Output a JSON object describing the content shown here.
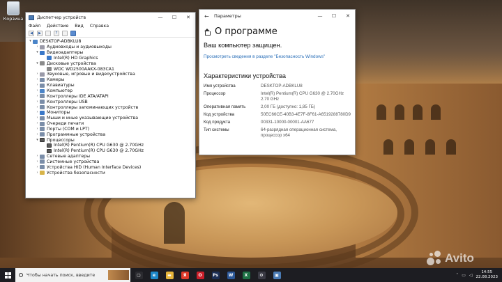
{
  "desktop": {
    "recycle_bin_label": "Корзина"
  },
  "device_manager": {
    "title": "Диспетчер устройств",
    "menu": [
      "Файл",
      "Действие",
      "Вид",
      "Справка"
    ],
    "tree": [
      {
        "level": 0,
        "toggle": "▾",
        "icon": "pc",
        "label": "DESKTOP-ADBKLU8"
      },
      {
        "level": 1,
        "toggle": "›",
        "icon": "snd",
        "label": "Аудиовходы и аудиовыходы"
      },
      {
        "level": 1,
        "toggle": "▾",
        "icon": "mon",
        "label": "Видеоадаптеры"
      },
      {
        "level": 2,
        "toggle": "",
        "icon": "mon",
        "label": "Intel(R) HD Graphics"
      },
      {
        "level": 1,
        "toggle": "▾",
        "icon": "hdd",
        "label": "Дисковые устройства"
      },
      {
        "level": 2,
        "toggle": "",
        "icon": "hdd",
        "label": "WDC WD2500AAKX-083CA1"
      },
      {
        "level": 1,
        "toggle": "›",
        "icon": "snd",
        "label": "Звуковые, игровые и видеоустройства"
      },
      {
        "level": 1,
        "toggle": "›",
        "icon": "dev",
        "label": "Камеры"
      },
      {
        "level": 1,
        "toggle": "›",
        "icon": "dev",
        "label": "Клавиатуры"
      },
      {
        "level": 1,
        "toggle": "›",
        "icon": "pc",
        "label": "Компьютер"
      },
      {
        "level": 1,
        "toggle": "›",
        "icon": "dev",
        "label": "Контроллеры IDE ATA/ATAPI"
      },
      {
        "level": 1,
        "toggle": "›",
        "icon": "dev",
        "label": "Контроллеры USB"
      },
      {
        "level": 1,
        "toggle": "›",
        "icon": "dev",
        "label": "Контроллеры запоминающих устройств"
      },
      {
        "level": 1,
        "toggle": "›",
        "icon": "mon",
        "label": "Мониторы"
      },
      {
        "level": 1,
        "toggle": "›",
        "icon": "dev",
        "label": "Мыши и иные указывающие устройства"
      },
      {
        "level": 1,
        "toggle": "›",
        "icon": "dev",
        "label": "Очереди печати"
      },
      {
        "level": 1,
        "toggle": "›",
        "icon": "dev",
        "label": "Порты (COM и LPT)"
      },
      {
        "level": 1,
        "toggle": "›",
        "icon": "dev",
        "label": "Программные устройства"
      },
      {
        "level": 1,
        "toggle": "▾",
        "icon": "cpu",
        "label": "Процессоры"
      },
      {
        "level": 2,
        "toggle": "",
        "icon": "cpu",
        "label": "Intel(R) Pentium(R) CPU G630 @ 2.70GHz"
      },
      {
        "level": 2,
        "toggle": "",
        "icon": "cpu",
        "label": "Intel(R) Pentium(R) CPU G630 @ 2.70GHz"
      },
      {
        "level": 1,
        "toggle": "›",
        "icon": "dev",
        "label": "Сетевые адаптеры"
      },
      {
        "level": 1,
        "toggle": "›",
        "icon": "dev",
        "label": "Системные устройства"
      },
      {
        "level": 1,
        "toggle": "›",
        "icon": "dev",
        "label": "Устройства HID (Human Interface Devices)"
      },
      {
        "level": 1,
        "toggle": "›",
        "icon": "warn",
        "label": "Устройства безопасности"
      }
    ]
  },
  "settings": {
    "title": "Параметры",
    "page_title": "О программе",
    "protected_text": "Ваш компьютер защищен.",
    "security_link": "Просмотреть сведения в разделе \"Безопасность Windows\"",
    "specs_heading": "Характеристики устройства",
    "specs": [
      {
        "key": "Имя устройства",
        "value": "DESKTOP-ADBKLU8"
      },
      {
        "key": "Процессор",
        "value": "Intel(R) Pentium(R) CPU G630 @ 2.70GHz 2.70 GHz"
      },
      {
        "key": "Оперативная память",
        "value": "2,00 ГБ (доступно: 1,85 ГБ)"
      },
      {
        "key": "Код устройства",
        "value": "50EC66CE-40B3-4E7F-8F61-A6519288780D9"
      },
      {
        "key": "Код продукта",
        "value": "00331-10000-00001-AA677"
      },
      {
        "key": "Тип системы",
        "value": "64-разрядная операционная система, процессор x64"
      }
    ]
  },
  "taskbar": {
    "search_placeholder": "Чтобы начать поиск, введите",
    "time": "14:55",
    "date": "22.08.2023",
    "apps": [
      {
        "name": "task-view",
        "color": "#2b2b30",
        "glyph": "▢"
      },
      {
        "name": "edge",
        "color": "#1e88c8",
        "glyph": "e"
      },
      {
        "name": "explorer",
        "color": "#e6b53a",
        "glyph": "▬"
      },
      {
        "name": "yandex",
        "color": "#e03a2a",
        "glyph": "Я"
      },
      {
        "name": "opera",
        "color": "#cc1f2a",
        "glyph": "O"
      },
      {
        "name": "photoshop",
        "color": "#1c2f55",
        "glyph": "Ps"
      },
      {
        "name": "word",
        "color": "#2b5797",
        "glyph": "W"
      },
      {
        "name": "excel",
        "color": "#1e7145",
        "glyph": "X"
      },
      {
        "name": "settings",
        "color": "#3a3a44",
        "glyph": "⚙"
      },
      {
        "name": "device-manager",
        "color": "#4a7bb5",
        "glyph": "▣"
      }
    ]
  },
  "watermark": {
    "text": "Avito"
  }
}
